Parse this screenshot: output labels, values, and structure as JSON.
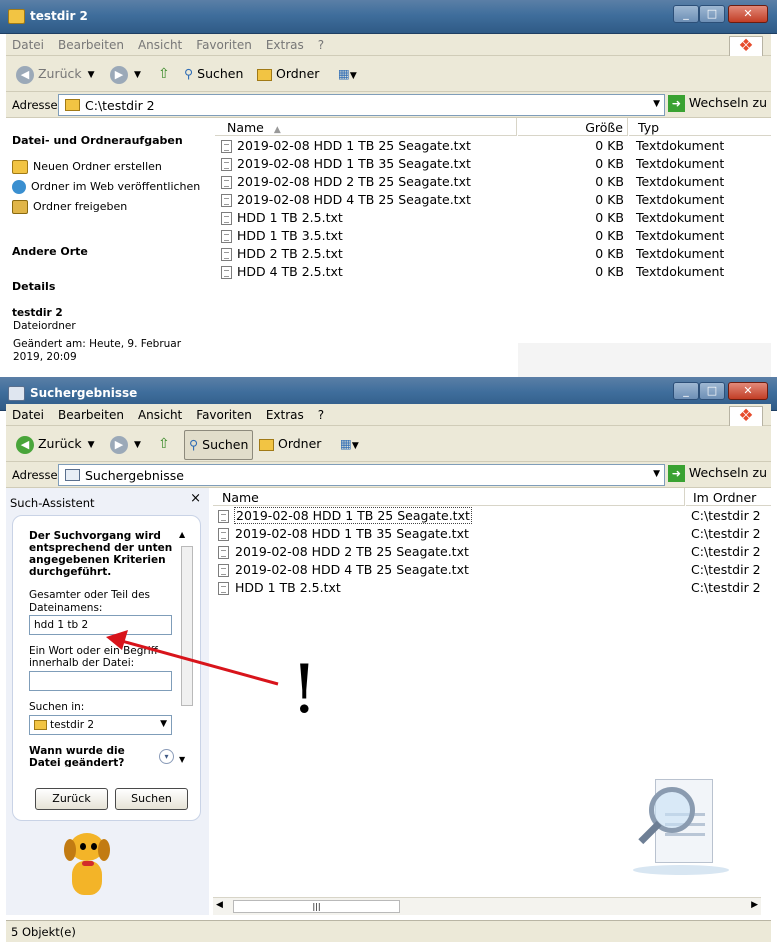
{
  "window1": {
    "title": "testdir 2",
    "menu": [
      "Datei",
      "Bearbeiten",
      "Ansicht",
      "Favoriten",
      "Extras",
      "?"
    ],
    "toolbar": {
      "back": "Zurück",
      "search": "Suchen",
      "folders": "Ordner"
    },
    "address": {
      "label": "Adresse",
      "value": "C:\\testdir 2",
      "go": "Wechseln zu"
    },
    "tasks": {
      "heading": "Datei- und Ordneraufgaben",
      "items": [
        "Neuen Ordner erstellen",
        "Ordner im Web veröffentlichen",
        "Ordner freigeben"
      ],
      "other_places": "Andere Orte",
      "details": "Details",
      "details_name": "testdir 2",
      "details_type": "Dateiordner",
      "details_changed_1": "Geändert am: Heute, 9. Februar",
      "details_changed_2": "2019, 20:09"
    },
    "columns": {
      "name": "Name",
      "size": "Größe",
      "type": "Typ"
    },
    "files": [
      {
        "name": "2019-02-08 HDD 1 TB 25 Seagate.txt",
        "size": "0 KB",
        "type": "Textdokument"
      },
      {
        "name": "2019-02-08 HDD 1 TB 35 Seagate.txt",
        "size": "0 KB",
        "type": "Textdokument"
      },
      {
        "name": "2019-02-08 HDD 2 TB 25 Seagate.txt",
        "size": "0 KB",
        "type": "Textdokument"
      },
      {
        "name": "2019-02-08 HDD 4 TB 25 Seagate.txt",
        "size": "0 KB",
        "type": "Textdokument"
      },
      {
        "name": "HDD 1 TB 2.5.txt",
        "size": "0 KB",
        "type": "Textdokument"
      },
      {
        "name": "HDD 1 TB 3.5.txt",
        "size": "0 KB",
        "type": "Textdokument"
      },
      {
        "name": "HDD 2 TB 2.5.txt",
        "size": "0 KB",
        "type": "Textdokument"
      },
      {
        "name": "HDD 4 TB 2.5.txt",
        "size": "0 KB",
        "type": "Textdokument"
      }
    ]
  },
  "window2": {
    "title": "Suchergebnisse",
    "menu": [
      "Datei",
      "Bearbeiten",
      "Ansicht",
      "Favoriten",
      "Extras",
      "?"
    ],
    "toolbar": {
      "back": "Zurück",
      "search": "Suchen",
      "folders": "Ordner"
    },
    "address": {
      "label": "Adresse",
      "value": "Suchergebnisse",
      "go": "Wechseln zu"
    },
    "assistant": {
      "title": "Such-Assistent",
      "intro": [
        "Der Suchvorgang wird",
        "entsprechend der unten",
        "angegebenen Kriterien",
        "durchgeführt."
      ],
      "name_label": [
        "Gesamter oder Teil des",
        "Dateinamens:"
      ],
      "name_value": "hdd 1 tb 2",
      "word_label": [
        "Ein Wort oder ein Begriff",
        "innerhalb der Datei:"
      ],
      "word_value": "",
      "lookin_label": "Suchen in:",
      "lookin_value": "testdir 2",
      "changed_label": [
        "Wann wurde die",
        "Datei geändert?"
      ],
      "back_button": "Zurück",
      "search_button": "Suchen"
    },
    "columns": {
      "name": "Name",
      "folder": "Im Ordner"
    },
    "results": [
      {
        "name": "2019-02-08 HDD 1 TB 25 Seagate.txt",
        "folder": "C:\\testdir 2"
      },
      {
        "name": "2019-02-08 HDD 1 TB 35 Seagate.txt",
        "folder": "C:\\testdir 2"
      },
      {
        "name": "2019-02-08 HDD 2 TB 25 Seagate.txt",
        "folder": "C:\\testdir 2"
      },
      {
        "name": "2019-02-08 HDD 4 TB 25 Seagate.txt",
        "folder": "C:\\testdir 2"
      },
      {
        "name": "HDD 1 TB 2.5.txt",
        "folder": "C:\\testdir 2"
      }
    ],
    "status": "5 Objekt(e)"
  },
  "annotation": {
    "mark": "!",
    "arrow_color": "#d8141b"
  }
}
